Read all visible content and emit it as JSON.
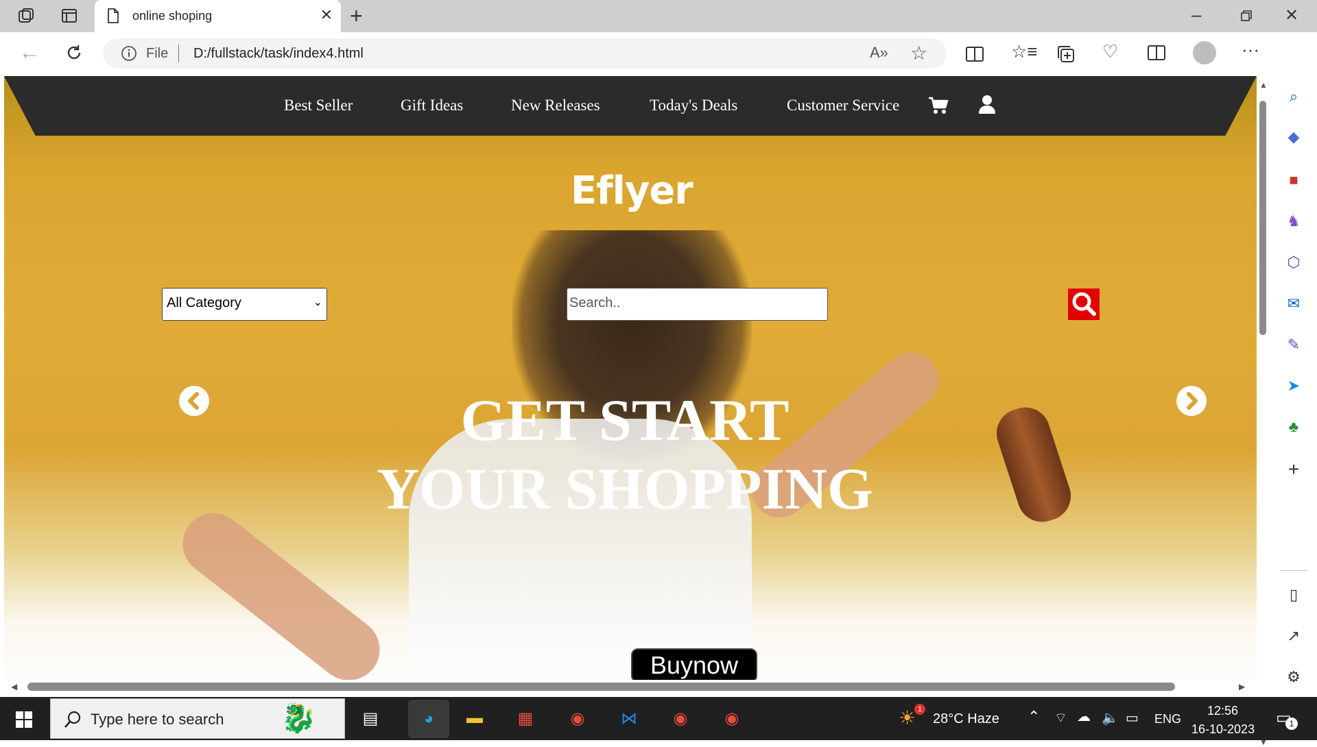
{
  "browser": {
    "tab_title": "online shoping",
    "address_scheme": "File",
    "url": "D:/fullstack/task/index4.html"
  },
  "nav": {
    "items": [
      "Best Seller",
      "Gift Ideas",
      "New Releases",
      "Today's Deals",
      "Customer Service"
    ]
  },
  "hero": {
    "logo": "Eflyer",
    "category_select": "All Category",
    "search_placeholder": "Search..",
    "headline_line1": "GET START",
    "headline_line2": "YOUR SHOPPING",
    "buy_button": "Buynow"
  },
  "taskbar": {
    "search_placeholder": "Type here to search",
    "weather": "28°C  Haze",
    "weather_badge": "1",
    "language": "ENG",
    "time": "12:56",
    "date": "16-10-2023",
    "notification_count": "1"
  },
  "colors": {
    "nav_bg": "#2b2b2b",
    "hero_yellow": "#e0ab36",
    "search_button": "#e30000",
    "buy_button": "#000000"
  }
}
